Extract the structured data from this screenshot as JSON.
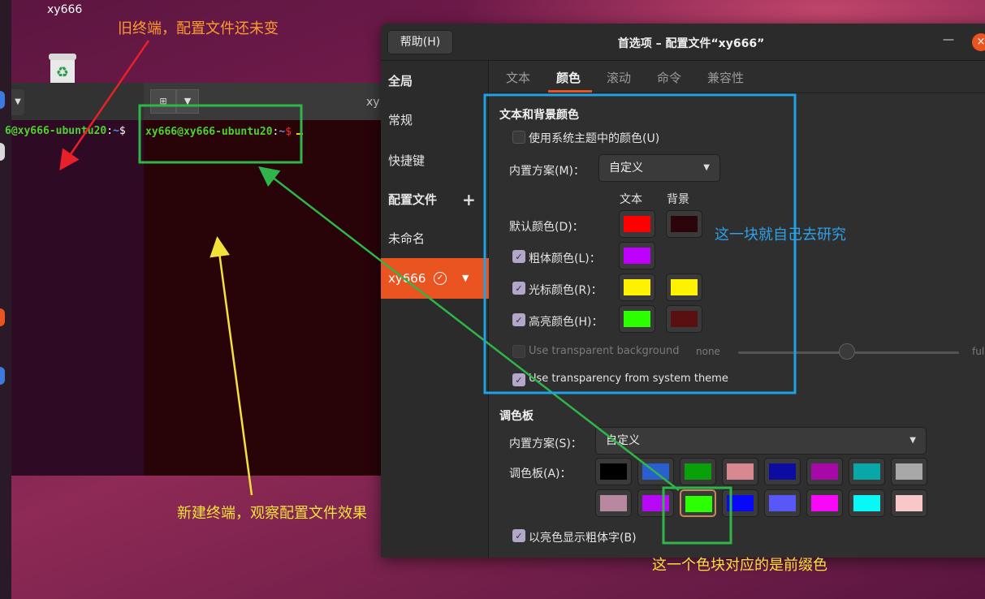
{
  "desktop": {
    "label": "xy666"
  },
  "old_terminal": {
    "prompt_user": "6@xy666-ubuntu20",
    "prompt_sep": ":",
    "prompt_path": "~",
    "prompt_dollar": "$"
  },
  "new_terminal": {
    "title": "xy",
    "prompt_user": "xy666@xy666-ubuntu20",
    "prompt_sep": ":",
    "prompt_path": "~",
    "prompt_dollar": "$",
    "cursor": "_"
  },
  "window": {
    "help_label": "帮助(H)",
    "title": "首选项 – 配置文件“xy666”",
    "min_label": "—",
    "close_label": "×"
  },
  "sidebar": {
    "global_header": "全局",
    "general": "常规",
    "shortcuts": "快捷键",
    "profiles_header": "配置文件",
    "add_label": "+",
    "unnamed": "未命名",
    "selected_profile": "xy666"
  },
  "tabs": [
    "文本",
    "颜色",
    "滚动",
    "命令",
    "兼容性"
  ],
  "colors_tab": {
    "section_title": "文本和背景颜色",
    "use_system_theme": "使用系统主题中的颜色(U)",
    "builtin_scheme_label": "内置方案(M)：",
    "builtin_scheme_value": "自定义",
    "col_text": "文本",
    "col_bg": "背景",
    "default_color_label": "默认颜色(D)：",
    "bold_color_label": "粗体颜色(L)：",
    "cursor_color_label": "光标颜色(R)：",
    "highlight_color_label": "高亮颜色(H)：",
    "use_transparent_bg": "Use transparent background",
    "transparency_min": "none",
    "transparency_max": "full",
    "use_system_transparency": "Use transparency from system theme",
    "swatch_colors": {
      "default_text": "#ff0000",
      "default_bg": "#2b0509",
      "bold_text": "#c000ff",
      "cursor_text": "#fff200",
      "cursor_bg": "#fff200",
      "highlight_text": "#2bff00",
      "highlight_bg": "#5a1010"
    }
  },
  "palette": {
    "title": "调色板",
    "scheme_label": "内置方案(S)：",
    "scheme_value": "自定义",
    "palette_label": "调色板(A)：",
    "row1": [
      "#000000",
      "#2a5fcf",
      "#0aa00a",
      "#d8888e",
      "#0c0ca0",
      "#a808a8",
      "#08a8a8",
      "#a8a8a8"
    ],
    "row2": [
      "#b888a0",
      "#b808f8",
      "#2bff00",
      "#0808f8",
      "#5858f8",
      "#f808f8",
      "#08f8f8",
      "#f8c8c8"
    ],
    "bright_bold": "以亮色显示粗体字(B)"
  },
  "annotations": {
    "old_terminal_note": "旧终端，配置文件还未变",
    "new_terminal_note": "新建终端，观察配置文件效果",
    "research_note": "这一块就自己去研究",
    "prefix_color_note": "这一个色块对应的是前缀色",
    "colors": {
      "red_arrow": "#e8202a",
      "yellow_arrow": "#f2e23a",
      "green_box": "#2fb54a",
      "blue_box": "#1ea2e6"
    }
  }
}
